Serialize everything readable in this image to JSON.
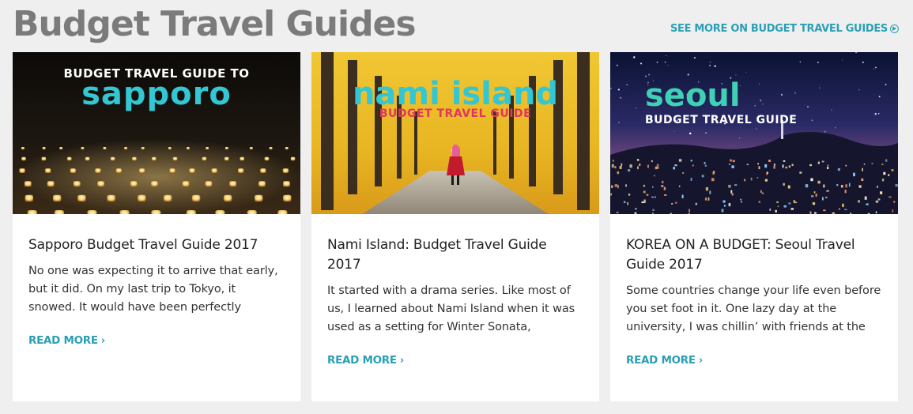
{
  "section": {
    "title": "Budget Travel Guides",
    "see_more_label": "SEE MORE ON BUDGET TRAVEL GUIDES"
  },
  "cards": [
    {
      "image_kicker": "BUDGET TRAVEL GUIDE TO",
      "image_title": "sapporo",
      "title": "Sapporo Budget Travel Guide 2017",
      "excerpt": "No one was expecting it to arrive that early, but it did. On my last trip to Tokyo, it snowed. It would have been perfectly",
      "read_more": "READ MORE"
    },
    {
      "image_title": "nami island",
      "image_subtitle": "BUDGET TRAVEL GUIDE",
      "title": "Nami Island: Budget Travel Guide 2017",
      "excerpt": "It started with a drama series. Like most of us, I learned about Nami Island when it was used as a setting for Winter Sonata,",
      "read_more": "READ MORE"
    },
    {
      "image_title": "seoul",
      "image_subtitle": "BUDGET TRAVEL GUIDE",
      "title": "KOREA ON A BUDGET: Seoul Travel Guide 2017",
      "excerpt": "Some countries change your life even before you set foot in it. One lazy day at the university, I was chillin’ with friends at the",
      "read_more": "READ MORE"
    }
  ],
  "colors": {
    "accent": "#2a9fb5",
    "title_gray": "#7b7b7b",
    "background": "#efefef",
    "image_text_teal": "#33c6d3",
    "image_text_pink": "#e0365f"
  },
  "icons": {
    "see_more": "circle-arrow-right-icon",
    "read_more": "chevron-right-icon"
  }
}
